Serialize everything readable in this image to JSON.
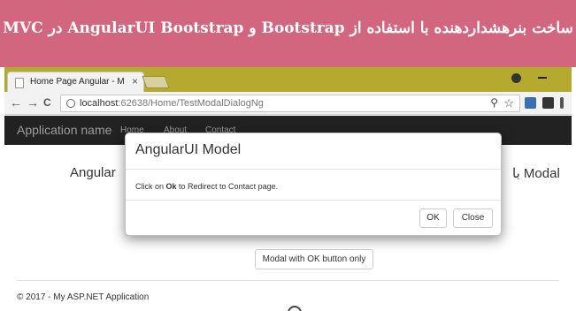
{
  "banner": {
    "title": "ساخت بنرهشداردهنده با استفاده از Bootstrap و AngularUI Bootstrap در MVC"
  },
  "browser": {
    "tab_title": "Home Page Angular - M",
    "tab_close": "×",
    "back": "←",
    "forward": "→",
    "reload": "C",
    "url_host": "localhost",
    "url_rest": ":62638/Home/TestModalDialogNg",
    "zoom": "⚲",
    "star": "☆"
  },
  "page": {
    "brand": "Application name",
    "nav": [
      "Home",
      "About",
      "Contact"
    ],
    "heading_left": "Angular",
    "heading_right": "Modal با",
    "ok_only_button": "Modal with OK button only",
    "footer": "© 2017 - My ASP.NET Application"
  },
  "modal": {
    "title": "AngularUI Model",
    "body_prefix": "Click on ",
    "body_bold": "Ok",
    "body_suffix": " to Redirect to Contact page.",
    "ok_button": "OK",
    "close_button": "Close"
  },
  "colors": {
    "banner": "#d3667f",
    "tabbar": "#b5aa2f",
    "navbar": "#222222"
  }
}
